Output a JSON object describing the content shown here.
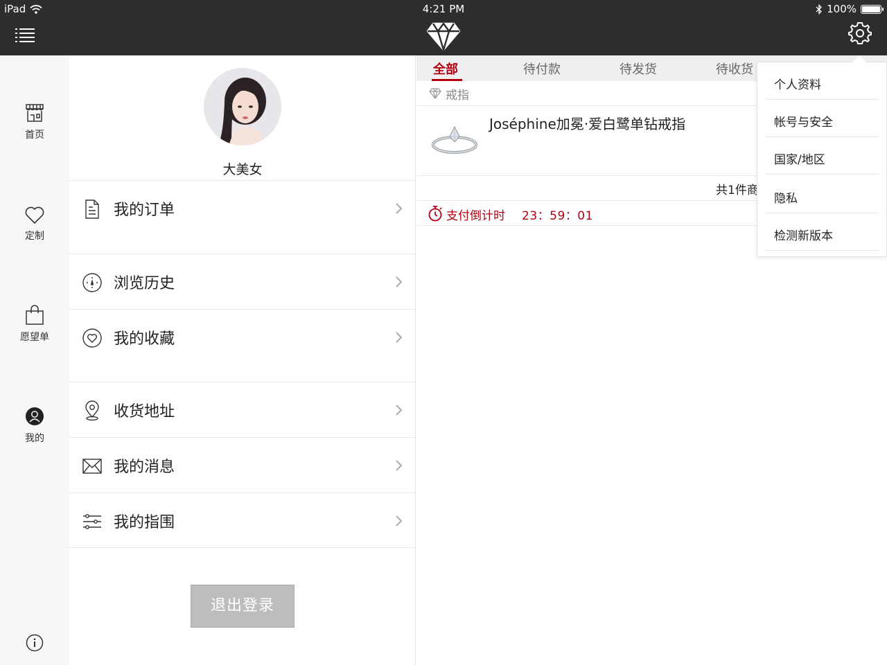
{
  "status_bar": {
    "device": "iPad",
    "time": "4:21 PM",
    "battery": "100%"
  },
  "sidebar": {
    "items": [
      {
        "label": "首页"
      },
      {
        "label": "定制"
      },
      {
        "label": "愿望单"
      },
      {
        "label": "我的"
      }
    ]
  },
  "profile": {
    "username": "大美女",
    "menu": [
      {
        "label": "我的订单"
      },
      {
        "label": "浏览历史"
      },
      {
        "label": "我的收藏"
      },
      {
        "label": "收货地址"
      },
      {
        "label": "我的消息"
      },
      {
        "label": "我的指围"
      }
    ],
    "logout_label": "退出登录"
  },
  "orders": {
    "tabs": [
      {
        "label": "全部",
        "active": true
      },
      {
        "label": "待付款"
      },
      {
        "label": "待发货"
      },
      {
        "label": "待收货"
      }
    ],
    "category": "戒指",
    "product_name": "Joséphine加冕·爱白鹭单钻戒指",
    "summary": "共1件商",
    "countdown_label": "支付倒计时",
    "countdown_time": "23：59：01"
  },
  "settings_menu": {
    "items": [
      {
        "label": "个人资料"
      },
      {
        "label": "帐号与安全"
      },
      {
        "label": "国家/地区"
      },
      {
        "label": "隐私"
      },
      {
        "label": "检测新版本"
      }
    ]
  },
  "colors": {
    "accent": "#b30010",
    "topbar": "#2d2d2d",
    "logout_bg": "#bdbdbd"
  }
}
